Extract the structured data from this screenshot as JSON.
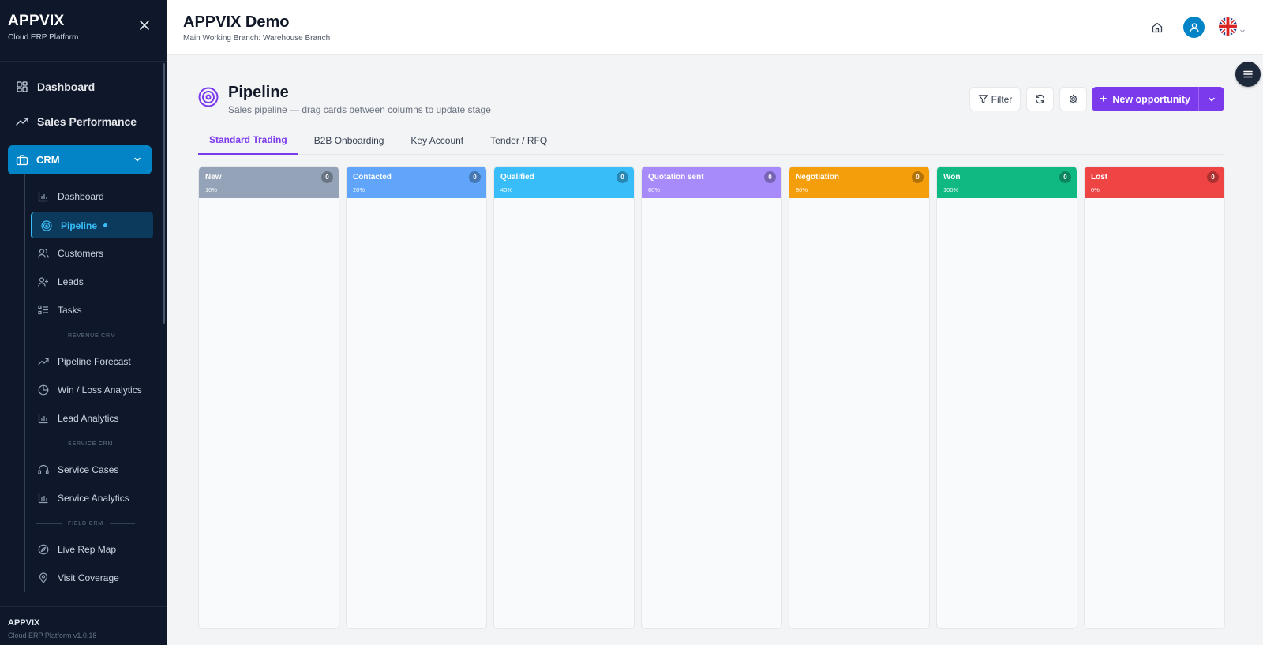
{
  "sidebar": {
    "brand": "APPVIX",
    "brand_sub": "Cloud ERP Platform",
    "top_items": [
      {
        "label": "Dashboard",
        "icon": "grid-icon"
      },
      {
        "label": "Sales Performance",
        "icon": "trend-up-icon"
      }
    ],
    "crm_label": "CRM",
    "crm_items": [
      {
        "label": "Dashboard",
        "icon": "bar-chart-icon"
      },
      {
        "label": "Pipeline",
        "icon": "target-icon",
        "active": true
      },
      {
        "label": "Customers",
        "icon": "users-icon"
      },
      {
        "label": "Leads",
        "icon": "user-plus-icon"
      },
      {
        "label": "Tasks",
        "icon": "list-check-icon"
      }
    ],
    "section_revenue": "REVENUE CRM",
    "revenue_items": [
      {
        "label": "Pipeline Forecast",
        "icon": "trend-up-icon"
      },
      {
        "label": "Win / Loss Analytics",
        "icon": "pie-chart-icon"
      },
      {
        "label": "Lead Analytics",
        "icon": "bar-chart-icon"
      }
    ],
    "section_service": "SERVICE CRM",
    "service_items": [
      {
        "label": "Service Cases",
        "icon": "headset-icon"
      },
      {
        "label": "Service Analytics",
        "icon": "bar-chart-icon"
      }
    ],
    "section_field": "FIELD CRM",
    "field_items": [
      {
        "label": "Live Rep Map",
        "icon": "compass-icon"
      },
      {
        "label": "Visit Coverage",
        "icon": "map-pin-icon"
      }
    ],
    "footer_title": "APPVIX",
    "footer_version": "Cloud ERP Platform v1.0.18"
  },
  "header": {
    "title": "APPVIX Demo",
    "branch": "Main Working Branch: Warehouse Branch"
  },
  "page": {
    "title": "Pipeline",
    "subtitle": "Sales pipeline — drag cards between columns to update stage",
    "filter_label": "Filter",
    "new_label": "New opportunity"
  },
  "tabs": [
    {
      "label": "Standard Trading",
      "active": true
    },
    {
      "label": "B2B Onboarding"
    },
    {
      "label": "Key Account"
    },
    {
      "label": "Tender / RFQ"
    }
  ],
  "columns": [
    {
      "name": "New",
      "pct": "10%",
      "count": "0",
      "color": "#94a3b8"
    },
    {
      "name": "Contacted",
      "pct": "20%",
      "count": "0",
      "color": "#60a5fa"
    },
    {
      "name": "Qualified",
      "pct": "40%",
      "count": "0",
      "color": "#38bdf8"
    },
    {
      "name": "Quotation sent",
      "pct": "60%",
      "count": "0",
      "color": "#a78bfa"
    },
    {
      "name": "Negotiation",
      "pct": "80%",
      "count": "0",
      "color": "#f59e0b"
    },
    {
      "name": "Won",
      "pct": "100%",
      "count": "0",
      "color": "#10b981"
    },
    {
      "name": "Lost",
      "pct": "0%",
      "count": "0",
      "color": "#ef4444"
    }
  ]
}
